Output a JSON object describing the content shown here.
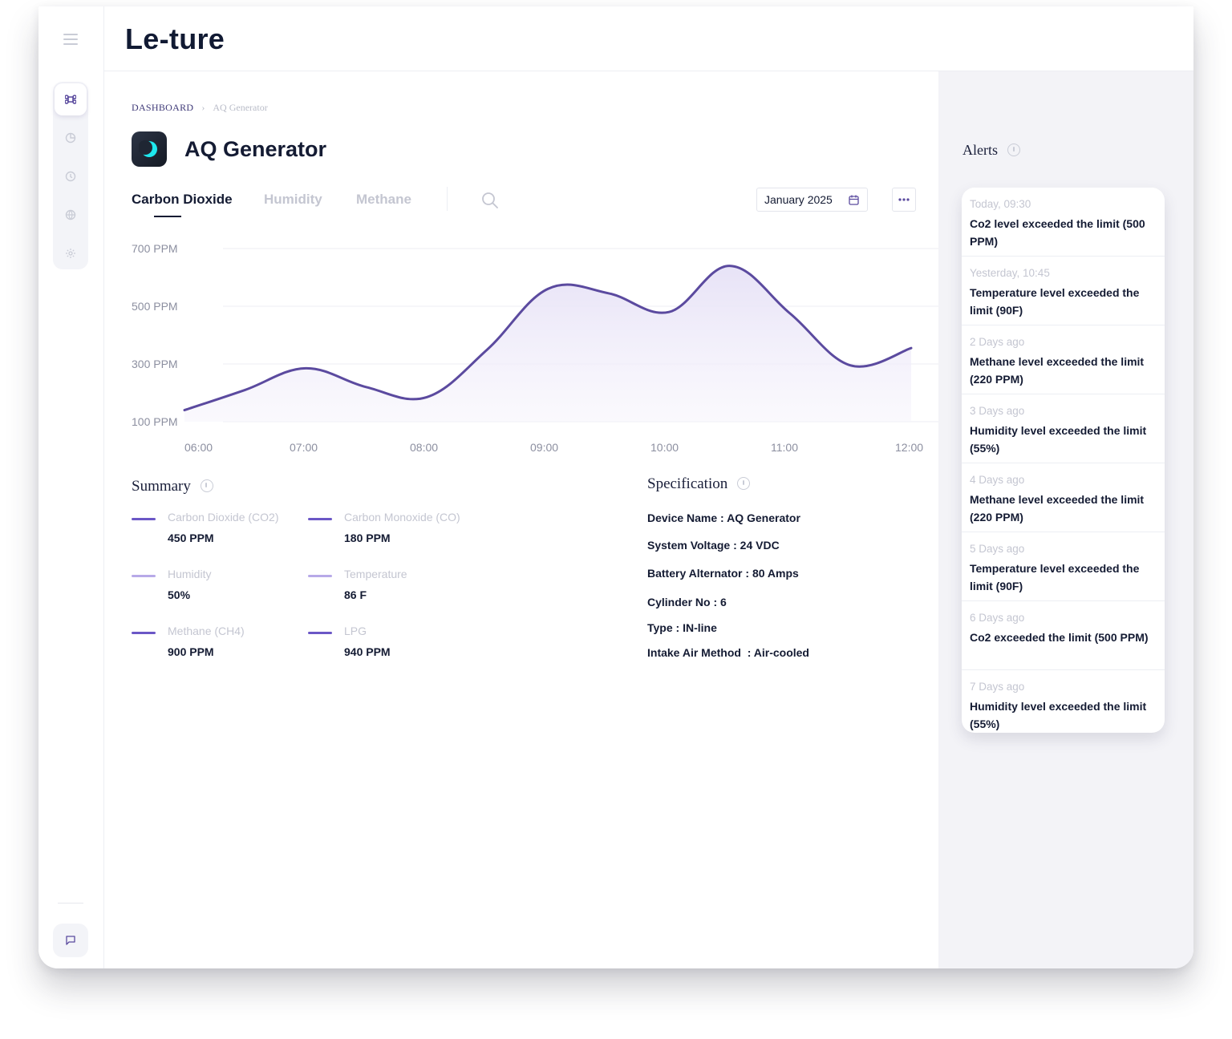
{
  "app": {
    "brand": "Le-ture"
  },
  "colors": {
    "accent": "#5a4a9e",
    "accent_light": "#b7a9e8",
    "line": "#5b4a9f"
  },
  "rail": {
    "icons": [
      "command-icon",
      "pie-chart-icon",
      "clock-icon",
      "globe-icon",
      "settings-icon"
    ],
    "bottom": "chat-icon"
  },
  "breadcrumb": {
    "root": "DASHBOARD",
    "current": "AQ Generator"
  },
  "page": {
    "title": "AQ Generator"
  },
  "tabs": [
    {
      "label": "Carbon Dioxide",
      "active": true
    },
    {
      "label": "Humidity",
      "active": false
    },
    {
      "label": "Methane",
      "active": false
    }
  ],
  "date_picker": {
    "value": "January 2025"
  },
  "chart_data": {
    "type": "area",
    "x": [
      "06:00",
      "06:30",
      "07:00",
      "07:30",
      "08:00",
      "08:30",
      "09:00",
      "09:30",
      "10:00",
      "10:30",
      "11:00",
      "11:30",
      "12:00"
    ],
    "series": [
      {
        "values": [
          140,
          210,
          285,
          220,
          185,
          350,
          560,
          545,
          480,
          640,
          475,
          295,
          355
        ]
      }
    ],
    "ylabels": [
      "700 PPM",
      "500 PPM",
      "300 PPM",
      "100 PPM"
    ],
    "xlabels": [
      "06:00",
      "07:00",
      "08:00",
      "09:00",
      "10:00",
      "11:00",
      "12:00"
    ],
    "ylim": [
      100,
      700
    ],
    "grid": true
  },
  "summary": {
    "title": "Summary",
    "items": [
      {
        "label": "Carbon Dioxide (CO2)",
        "value": "450 PPM",
        "color": "#6b57c6"
      },
      {
        "label": "Carbon Monoxide (CO)",
        "value": "180 PPM",
        "color": "#6b57c6"
      },
      {
        "label": "Humidity",
        "value": "50%",
        "color": "#b7a9e8"
      },
      {
        "label": "Temperature",
        "value": "86 F",
        "color": "#b7a9e8"
      },
      {
        "label": "Methane (CH4)",
        "value": "900 PPM",
        "color": "#6b57c6"
      },
      {
        "label": "LPG",
        "value": "940 PPM",
        "color": "#6b57c6"
      }
    ]
  },
  "specification": {
    "title": "Specification",
    "rows": [
      "Device Name : AQ Generator",
      "System Voltage : 24 VDC",
      "Battery Alternator : 80 Amps",
      "Cylinder No : 6",
      "Type : IN-line",
      "Intake Air Method  : Air-cooled"
    ]
  },
  "alerts": {
    "title": "Alerts",
    "items": [
      {
        "time": "Today, 09:30",
        "message": "Co2 level exceeded the limit (500 PPM)"
      },
      {
        "time": "Yesterday, 10:45",
        "message": "Temperature level exceeded the limit (90F)"
      },
      {
        "time": "2 Days ago",
        "message": "Methane level exceeded the limit (220 PPM)"
      },
      {
        "time": "3 Days ago",
        "message": "Humidity level exceeded the limit (55%)"
      },
      {
        "time": "4 Days ago",
        "message": "Methane level exceeded the limit (220 PPM)"
      },
      {
        "time": "5 Days ago",
        "message": "Temperature level exceeded the limit (90F)"
      },
      {
        "time": "6 Days ago",
        "message": "Co2 exceeded the limit (500 PPM)"
      },
      {
        "time": "7 Days ago",
        "message": "Humidity level exceeded the limit (55%)"
      }
    ]
  }
}
